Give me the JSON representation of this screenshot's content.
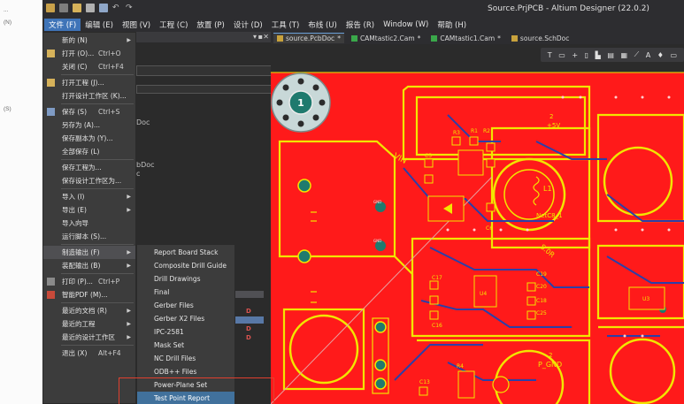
{
  "app": {
    "title": "Source.PrjPCB - Altium Designer (22.0.2)"
  },
  "outside_strip": {
    "lines": [
      "...",
      "(N)",
      "(S)"
    ]
  },
  "menubar": {
    "items": [
      {
        "label": "文件 (F)",
        "active": true
      },
      {
        "label": "编辑 (E)"
      },
      {
        "label": "视图 (V)"
      },
      {
        "label": "工程 (C)"
      },
      {
        "label": "放置 (P)"
      },
      {
        "label": "设计 (D)"
      },
      {
        "label": "工具 (T)"
      },
      {
        "label": "布线 (U)"
      },
      {
        "label": "报告 (R)"
      },
      {
        "label": "Window (W)"
      },
      {
        "label": "帮助 (H)"
      }
    ]
  },
  "tabs": [
    {
      "label": "source.PcbDoc",
      "modified": "*",
      "active": true,
      "color": "#c8a23c"
    },
    {
      "label": "CAMtastic2.Cam",
      "modified": "*",
      "color": "#3aa84a"
    },
    {
      "label": "CAMtastic1.Cam",
      "modified": "*",
      "color": "#3aa84a"
    },
    {
      "label": "source.SchDoc",
      "color": "#c8a23c"
    }
  ],
  "toolbar": {
    "tools": [
      "T",
      "▭",
      "+",
      "▯",
      "▙",
      "▤",
      "▦",
      "⟋",
      "A",
      "♦",
      "▭"
    ]
  },
  "left_panel": {
    "lines": [
      "Doc",
      "bDoc",
      "c"
    ],
    "pdf_marks": [
      "D",
      "D",
      "D"
    ]
  },
  "file_menu": {
    "items": [
      {
        "label": "新的 (N)",
        "shortcut": "",
        "arrow": true,
        "icon": ""
      },
      {
        "label": "打开 (O)...",
        "shortcut": "Ctrl+O",
        "icon": "folder-icon"
      },
      {
        "label": "关闭 (C)",
        "shortcut": "Ctrl+F4",
        "icon": ""
      },
      {
        "label": "打开工程 (J)...",
        "shortcut": "",
        "icon": "folder-icon"
      },
      {
        "label": "打开设计工作区 (K)...",
        "shortcut": "",
        "icon": ""
      },
      {
        "label": "保存 (S)",
        "shortcut": "Ctrl+S",
        "icon": "save-icon"
      },
      {
        "label": "另存为 (A)...",
        "shortcut": "",
        "icon": ""
      },
      {
        "label": "保存副本为 (Y)...",
        "shortcut": "",
        "icon": ""
      },
      {
        "label": "全部保存 (L)",
        "shortcut": "",
        "icon": ""
      },
      {
        "label": "保存工程为...",
        "shortcut": "",
        "icon": ""
      },
      {
        "label": "保存设计工作区为...",
        "shortcut": "",
        "icon": ""
      },
      {
        "label": "导入 (I)",
        "shortcut": "",
        "arrow": true,
        "icon": ""
      },
      {
        "label": "导出 (E)",
        "shortcut": "",
        "arrow": true,
        "icon": ""
      },
      {
        "label": "导入向导",
        "shortcut": "",
        "icon": ""
      },
      {
        "label": "运行脚本 (S)...",
        "shortcut": "",
        "icon": ""
      },
      {
        "label": "制造输出 (F)",
        "shortcut": "",
        "arrow": true,
        "icon": "",
        "hover": true
      },
      {
        "label": "装配输出 (B)",
        "shortcut": "",
        "arrow": true,
        "icon": ""
      },
      {
        "label": "打印 (P)...",
        "shortcut": "Ctrl+P",
        "icon": "print-icon"
      },
      {
        "label": "智能PDF (M)...",
        "shortcut": "",
        "icon": "pdf-icon"
      },
      {
        "label": "最近的文档 (R)",
        "shortcut": "",
        "arrow": true,
        "icon": ""
      },
      {
        "label": "最近的工程",
        "shortcut": "",
        "arrow": true,
        "icon": ""
      },
      {
        "label": "最近的设计工作区",
        "shortcut": "",
        "arrow": true,
        "icon": ""
      },
      {
        "label": "退出 (X)",
        "shortcut": "Alt+F4",
        "icon": ""
      }
    ]
  },
  "fab_submenu": {
    "items": [
      {
        "label": "Report Board Stack"
      },
      {
        "label": "Composite Drill Guide"
      },
      {
        "label": "Drill Drawings"
      },
      {
        "label": "Final"
      },
      {
        "label": "Gerber Files"
      },
      {
        "label": "Gerber X2 Files"
      },
      {
        "label": "IPC-2581"
      },
      {
        "label": "Mask Set"
      },
      {
        "label": "NC Drill Files"
      },
      {
        "label": "ODB++ Files"
      },
      {
        "label": "Power-Plane Set"
      },
      {
        "label": "Test Point Report",
        "hover": true
      }
    ]
  },
  "pcb": {
    "colors": {
      "copper": "#ff1a1a",
      "silk": "#f2e600",
      "bottom": "#2c3fa8",
      "pad": "#1f7a6e",
      "bg": "#2a2a2a"
    },
    "labels": {
      "fiducial": "1",
      "vin": "VIN",
      "r3": "R3",
      "r2": "R2",
      "r1": "R1",
      "c5": "C5",
      "c6": "C6",
      "c17": "C17",
      "c16": "C16",
      "c18": "C18",
      "c19": "C19",
      "c20": "C20",
      "c25": "C25",
      "c13": "C13",
      "u4": "U4",
      "u3": "U3",
      "r4": "R4",
      "l1": "L1",
      "s0r": "S.0R",
      "netc8": "NetC8_1",
      "p_gnd": "P_GND",
      "plus5v": "+5V",
      "two_a": "2",
      "two_b": "2",
      "gnd_a": "GND",
      "gnd_b": "GND"
    }
  }
}
